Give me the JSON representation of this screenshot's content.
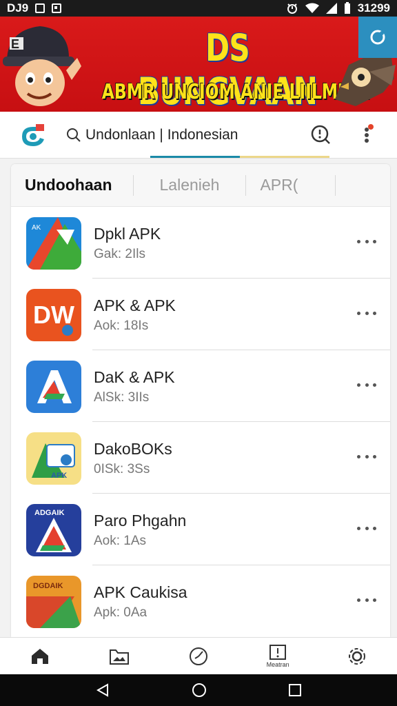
{
  "status_bar": {
    "left_text": "DJ9",
    "time": "31299",
    "icons": [
      "window-icon",
      "image-icon",
      "alarm-icon",
      "wifi-icon",
      "signal-icon",
      "battery-icon"
    ]
  },
  "banner": {
    "mascot_badge": "E",
    "title": "DS BUNGVAAN",
    "subtitle": "ABMR UNCIOM ANIE LIILMNA!",
    "colors": {
      "background": "#d91a1a",
      "text": "#ffe21a",
      "outline": "#1f3d9a"
    }
  },
  "search": {
    "query": "Undonlaan | Indonesian"
  },
  "tabs": [
    {
      "label": "Undoohaan",
      "active": true
    },
    {
      "label": "Lalenieh",
      "active": false
    },
    {
      "label": "APR(",
      "active": false
    }
  ],
  "apps": [
    {
      "name": "Dpkl APK",
      "meta": "Gak: 2Ils",
      "icon": "apk-triangle-blue-icon"
    },
    {
      "name": "APK & APK",
      "meta": "Aok: 18Is",
      "icon": "dw-orange-icon"
    },
    {
      "name": "DaK & APK",
      "meta": "AlSk: 3IIs",
      "icon": "apk-a-blue-icon"
    },
    {
      "name": "DakoBOKs",
      "meta": "0ISk: 3Ss",
      "icon": "apk-yellow-icon"
    },
    {
      "name": "Paro Phgahn",
      "meta": "Aok: 1As",
      "icon": "adgaik-a-icon"
    },
    {
      "name": "APK Caukisa",
      "meta": "Apk: 0Aa",
      "icon": "dgdaik-orange-icon"
    }
  ],
  "bottom_nav": [
    {
      "icon": "home-icon",
      "label": ""
    },
    {
      "icon": "folder-image-icon",
      "label": ""
    },
    {
      "icon": "clock-icon",
      "label": ""
    },
    {
      "icon": "download-box-icon",
      "label": "Meatran"
    },
    {
      "icon": "settings-gear-icon",
      "label": ""
    }
  ]
}
